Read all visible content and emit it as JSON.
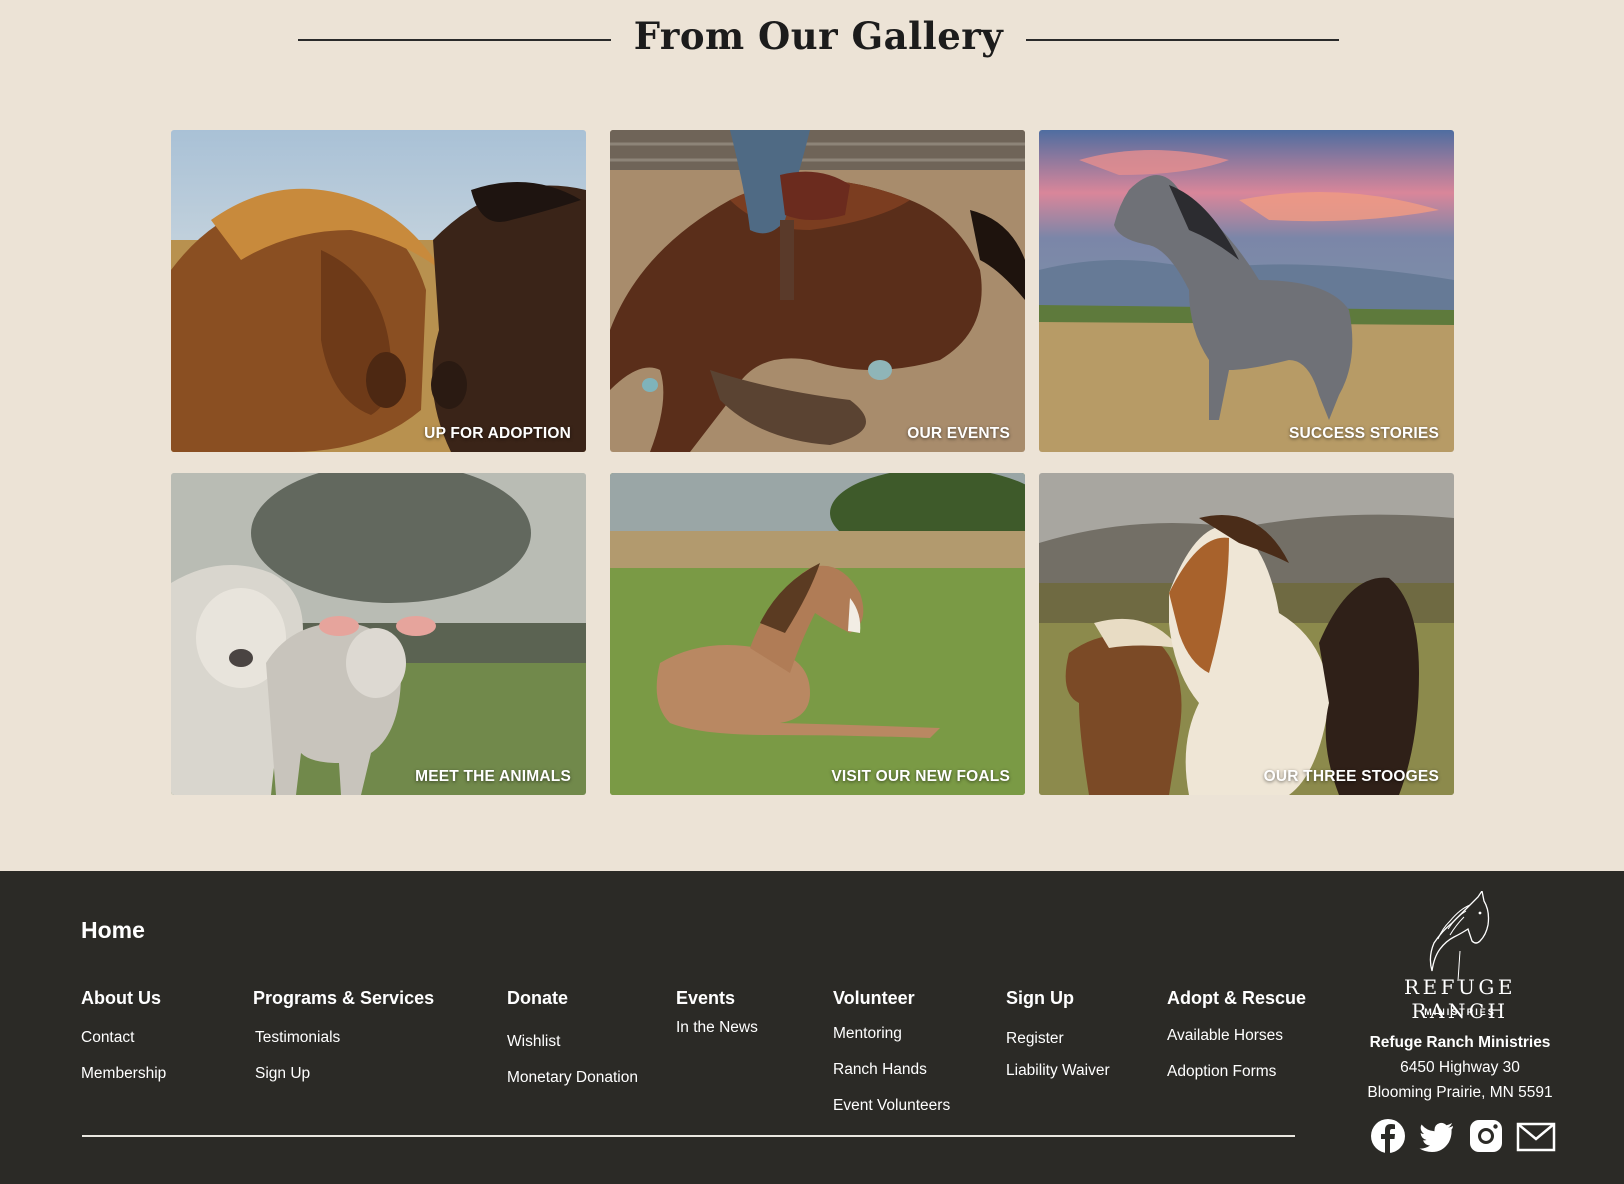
{
  "gallery": {
    "title": "From Our Gallery",
    "tiles": [
      {
        "label": "UP FOR ADOPTION"
      },
      {
        "label": "OUR EVENTS"
      },
      {
        "label": "SUCCESS STORIES"
      },
      {
        "label": "MEET THE ANIMALS"
      },
      {
        "label": "VISIT OUR NEW FOALS"
      },
      {
        "label": "OUR THREE STOOGES"
      }
    ]
  },
  "footer": {
    "home": "Home",
    "columns": [
      {
        "heading": "About Us",
        "links": [
          "Contact",
          "Membership"
        ]
      },
      {
        "heading": "Programs & Services",
        "links": [
          "Testimonials",
          "Sign Up"
        ]
      },
      {
        "heading": "Donate",
        "links": [
          "Wishlist",
          "Monetary Donation"
        ]
      },
      {
        "heading": "Events",
        "links": [
          "In the News"
        ]
      },
      {
        "heading": "Volunteer",
        "links": [
          "Mentoring",
          "Ranch Hands",
          "Event Volunteers"
        ]
      },
      {
        "heading": "Sign Up",
        "links": [
          "Register",
          "Liability Waiver"
        ]
      },
      {
        "heading": "Adopt & Rescue",
        "links": [
          "Available Horses",
          "Adoption Forms"
        ]
      }
    ],
    "brand": {
      "logo_word": "REFUGE RANCH",
      "logo_sub": "MINISTRIES",
      "name": "Refuge Ranch Ministries",
      "address_line1": "6450 Highway 30",
      "address_line2": "Blooming Prairie, MN 5591"
    },
    "social_icons": [
      "facebook-icon",
      "twitter-icon",
      "instagram-icon",
      "mail-icon"
    ]
  },
  "colors": {
    "page_background": "#ece3d6",
    "footer_background": "#2b2a26",
    "text_light": "#ffffff"
  }
}
